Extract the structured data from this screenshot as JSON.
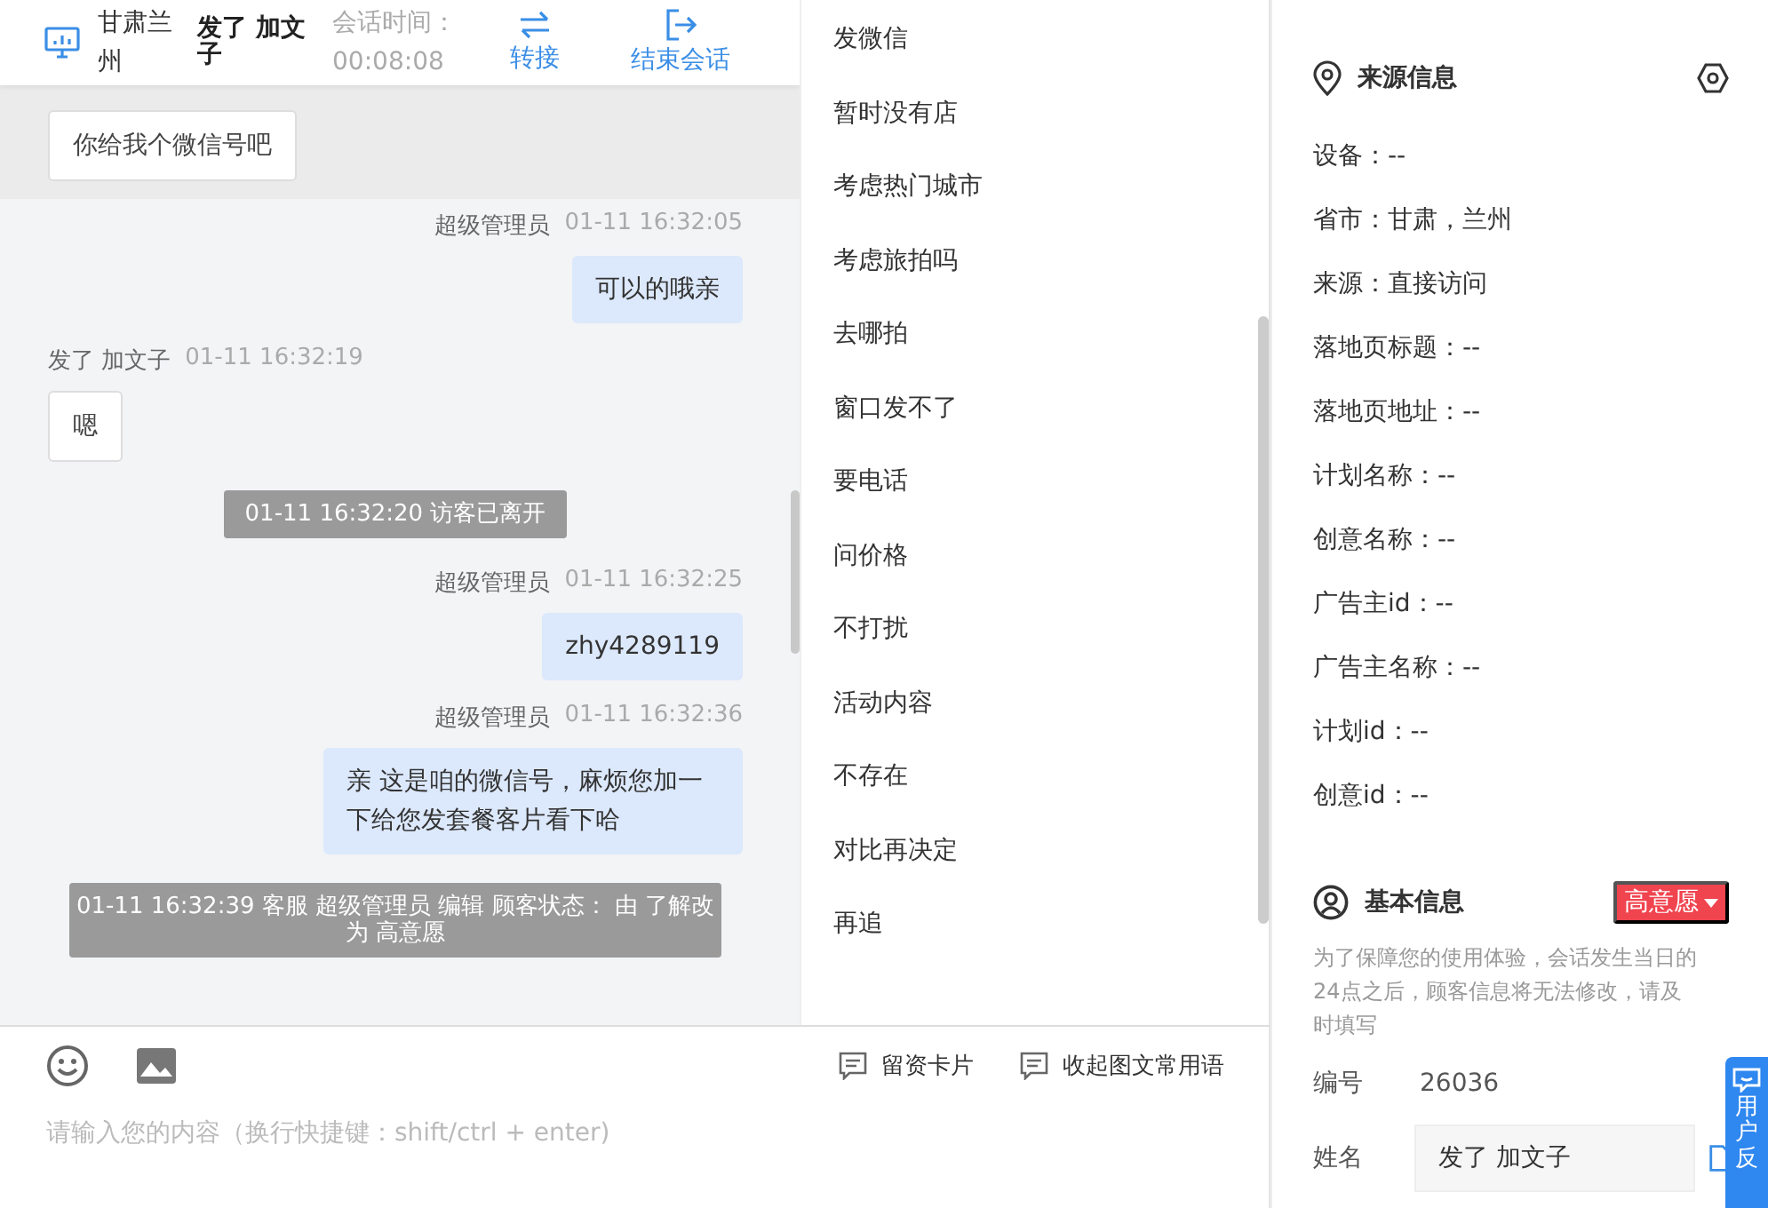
{
  "header": {
    "location": "甘肃兰州",
    "visitor": "发了 加文子",
    "timer_label": "会话时间：",
    "timer": "00:08:08",
    "actions": [
      {
        "kind": "transfer",
        "label": "转接"
      },
      {
        "kind": "end",
        "label": "结束会话"
      }
    ]
  },
  "messages": [
    {
      "kind": "visitor",
      "highlighted": true,
      "text": "你给我个微信号吧"
    },
    {
      "kind": "agent",
      "highlighted": false,
      "sender": "超级管理员",
      "time": "01-11 16:32:05",
      "text": "可以的哦亲"
    },
    {
      "kind": "visitor",
      "highlighted": false,
      "sender": "发了 加文子",
      "time": "01-11 16:32:19",
      "text": "嗯"
    },
    {
      "kind": "system",
      "highlighted": false,
      "text": "01-11 16:32:20 访客已离开"
    },
    {
      "kind": "agent",
      "highlighted": false,
      "sender": "超级管理员",
      "time": "01-11 16:32:25",
      "text": "zhy4289119"
    },
    {
      "kind": "agent",
      "highlighted": false,
      "sender": "超级管理员",
      "time": "01-11 16:32:36",
      "text": "亲 这是咱的微信号，麻烦您加一下给您发套餐客片看下哈"
    },
    {
      "kind": "system",
      "highlighted": false,
      "text": "01-11 16:32:39 客服 超级管理员 编辑 顾客状态： 由 了解改为 高意愿"
    }
  ],
  "quick_replies": [
    "发微信",
    "暂时没有店",
    "考虑热门城市",
    "考虑旅拍吗",
    "去哪拍",
    "窗口发不了",
    "要电话",
    "问价格",
    "不打扰",
    "活动内容",
    "不存在",
    "对比再决定",
    "再追"
  ],
  "composer": {
    "tools": [
      {
        "label": "留资卡片"
      },
      {
        "label": "收起图文常用语"
      }
    ],
    "placeholder": "请输入您的内容（换行快捷键：shift/ctrl + enter)"
  },
  "source_info": {
    "title": "来源信息",
    "rows": [
      "设备：--",
      "省市：甘肃，兰州",
      "来源：直接访问",
      "落地页标题：--",
      "落地页地址：--",
      "计划名称：--",
      "创意名称：--",
      "广告主id：--",
      "广告主名称：--",
      "计划id：--",
      "创意id：--"
    ]
  },
  "basic_info": {
    "title": "基本信息",
    "tag": "高意愿",
    "note": "为了保障您的使用体验，会话发生当日的24点之后，顾客信息将无法修改，请及时填写",
    "id_label": "编号",
    "id_value": "26036",
    "name_label": "姓名",
    "name_value": "发了 加文子"
  },
  "feedback": {
    "label": "用户反"
  }
}
